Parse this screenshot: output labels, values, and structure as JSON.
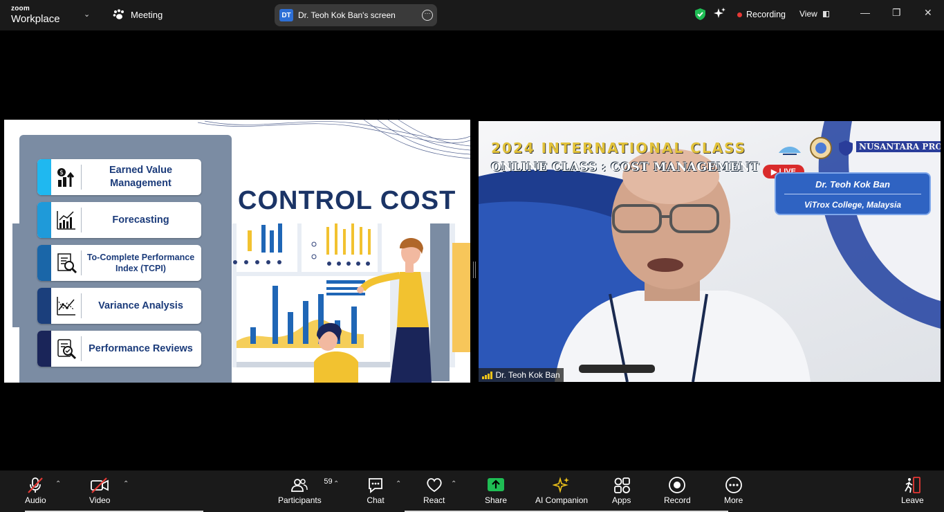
{
  "app": {
    "brand_top": "zoom",
    "brand_bottom": "Workplace",
    "meeting_label": "Meeting"
  },
  "share": {
    "initials": "DT",
    "label": "Dr. Teoh Kok Ban's screen"
  },
  "status": {
    "recording": "Recording",
    "view": "View"
  },
  "slide": {
    "title": "CONTROL COST",
    "cards": [
      {
        "label": "Earned Value Management",
        "icon": "dollar-growth-icon",
        "strip": "#1fb8f0"
      },
      {
        "label": "Forecasting",
        "icon": "chart-growth-icon",
        "strip": "#1f9ad9"
      },
      {
        "label": "To-Complete Performance Index (TCPI)",
        "icon": "document-search-icon",
        "strip": "#1a66a8"
      },
      {
        "label": "Variance Analysis",
        "icon": "trend-chart-icon",
        "strip": "#1b3f7c"
      },
      {
        "label": "Performance Reviews",
        "icon": "review-search-icon",
        "strip": "#1a2559"
      }
    ]
  },
  "video": {
    "banner_line1": "2024 INTERNATIONAL CLASS",
    "banner_line2": "ONLINE CLASS : COST MANAGEMENT",
    "live": "LIVE",
    "logo_text": "NUSANTARA PROJECT",
    "presenter_name": "Dr. Teoh Kok Ban",
    "presenter_org": "ViTrox College, Malaysia",
    "participant_name": "Dr. Teoh Kok Ban"
  },
  "toolbar": {
    "audio": "Audio",
    "video": "Video",
    "participants": "Participants",
    "participant_count": "59",
    "chat": "Chat",
    "react": "React",
    "share": "Share",
    "ai_companion": "AI Companion",
    "apps": "Apps",
    "record": "Record",
    "more": "More",
    "leave": "Leave"
  },
  "colors": {
    "topbar": "#1a1a1a",
    "share_green": "#1fbd54",
    "record_red": "#e53935",
    "slide_title": "#1b3466",
    "card_text": "#1b3b7a"
  }
}
